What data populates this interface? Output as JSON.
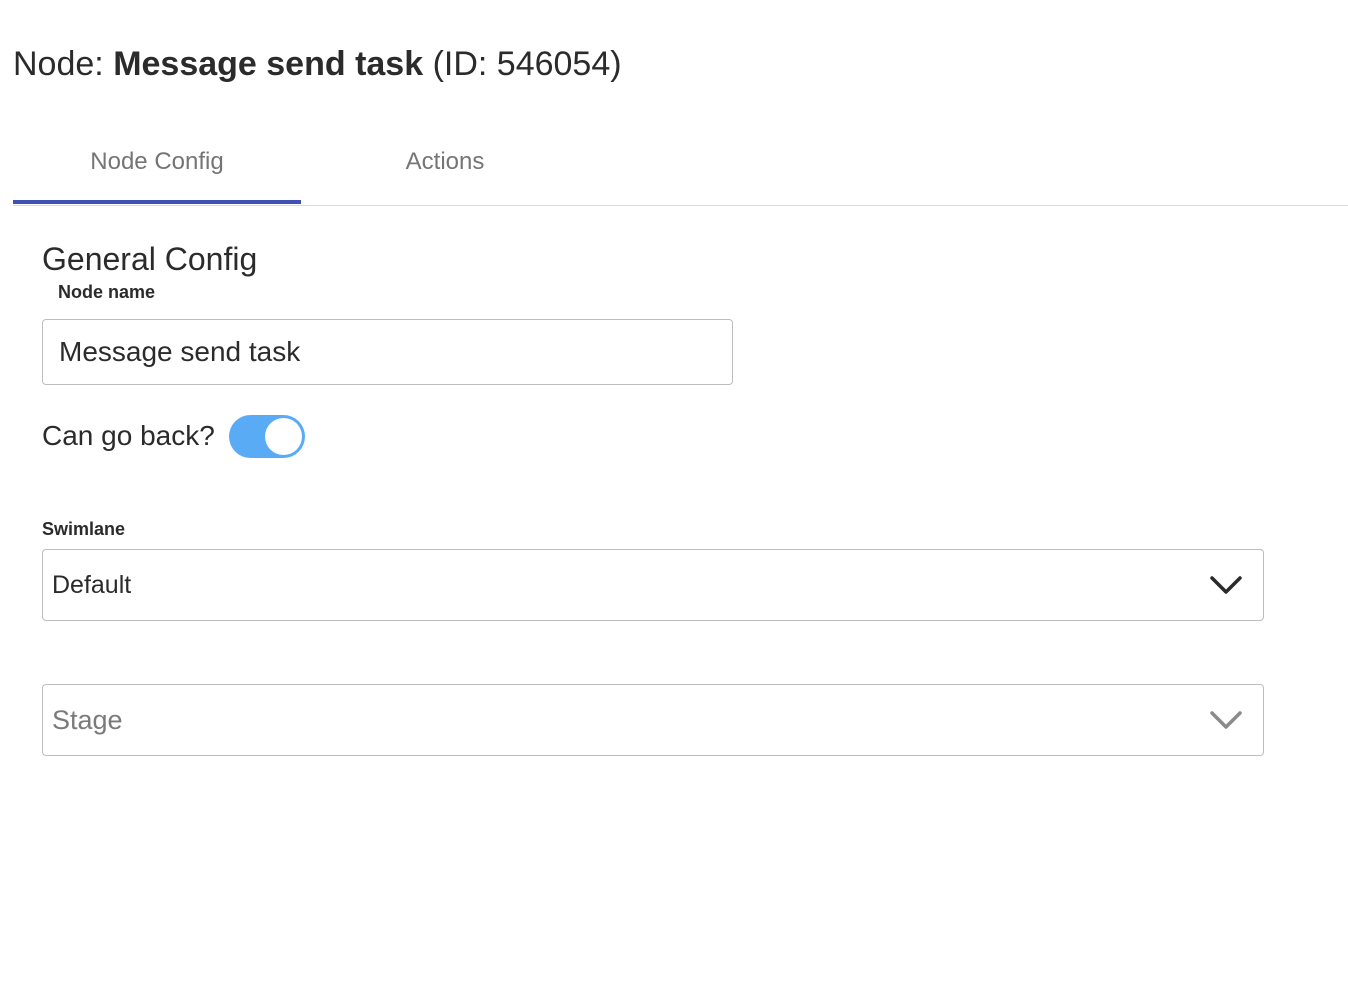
{
  "header": {
    "prefix": "Node: ",
    "node_name": "Message send task",
    "id_text": " (ID: 546054)"
  },
  "tabs": [
    {
      "label": "Node Config",
      "active": true
    },
    {
      "label": "Actions",
      "active": false
    }
  ],
  "colors": {
    "accent": "#3f51b5",
    "toggle_on": "#5aabf6"
  },
  "general_config": {
    "title": "General Config",
    "node_name_label": "Node name",
    "node_name_value": "Message send task",
    "can_go_back_label": "Can go back?",
    "can_go_back": true,
    "swimlane_label": "Swimlane",
    "swimlane_value": "Default",
    "stage_placeholder": "Stage"
  },
  "icons": {
    "select_arrow": "chevron-down-icon"
  }
}
